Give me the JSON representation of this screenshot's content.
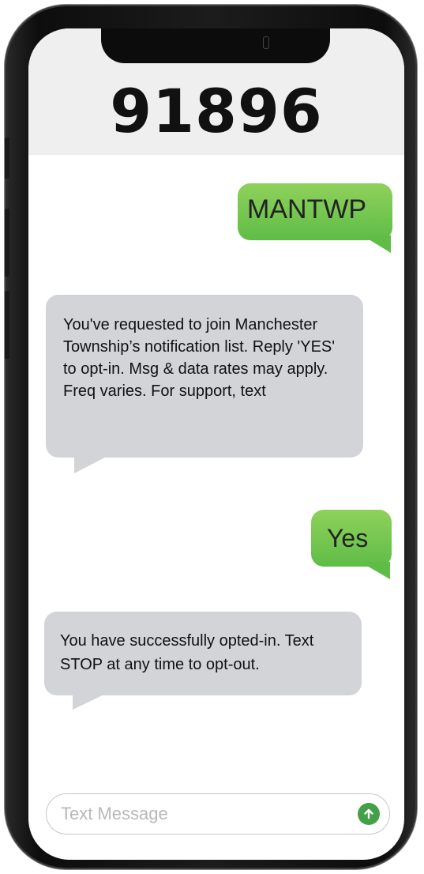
{
  "header": {
    "title": "91896"
  },
  "messages": [
    {
      "direction": "sent",
      "text": "MANTWP"
    },
    {
      "direction": "received",
      "text": "You've requested to join Manchester Township’s notification list. Reply 'YES' to opt-in. Msg & data rates may apply. Freq varies. For support, text"
    },
    {
      "direction": "sent",
      "text": "Yes"
    },
    {
      "direction": "received",
      "text": "You have successfully opted-in. Text STOP at any time to opt-out."
    }
  ],
  "composer": {
    "placeholder": "Text Message",
    "send_icon": "arrow-up-icon"
  },
  "colors": {
    "sent_bubble": "#6cc24a",
    "received_bubble": "#d3d4d8",
    "send_button": "#43a047"
  }
}
